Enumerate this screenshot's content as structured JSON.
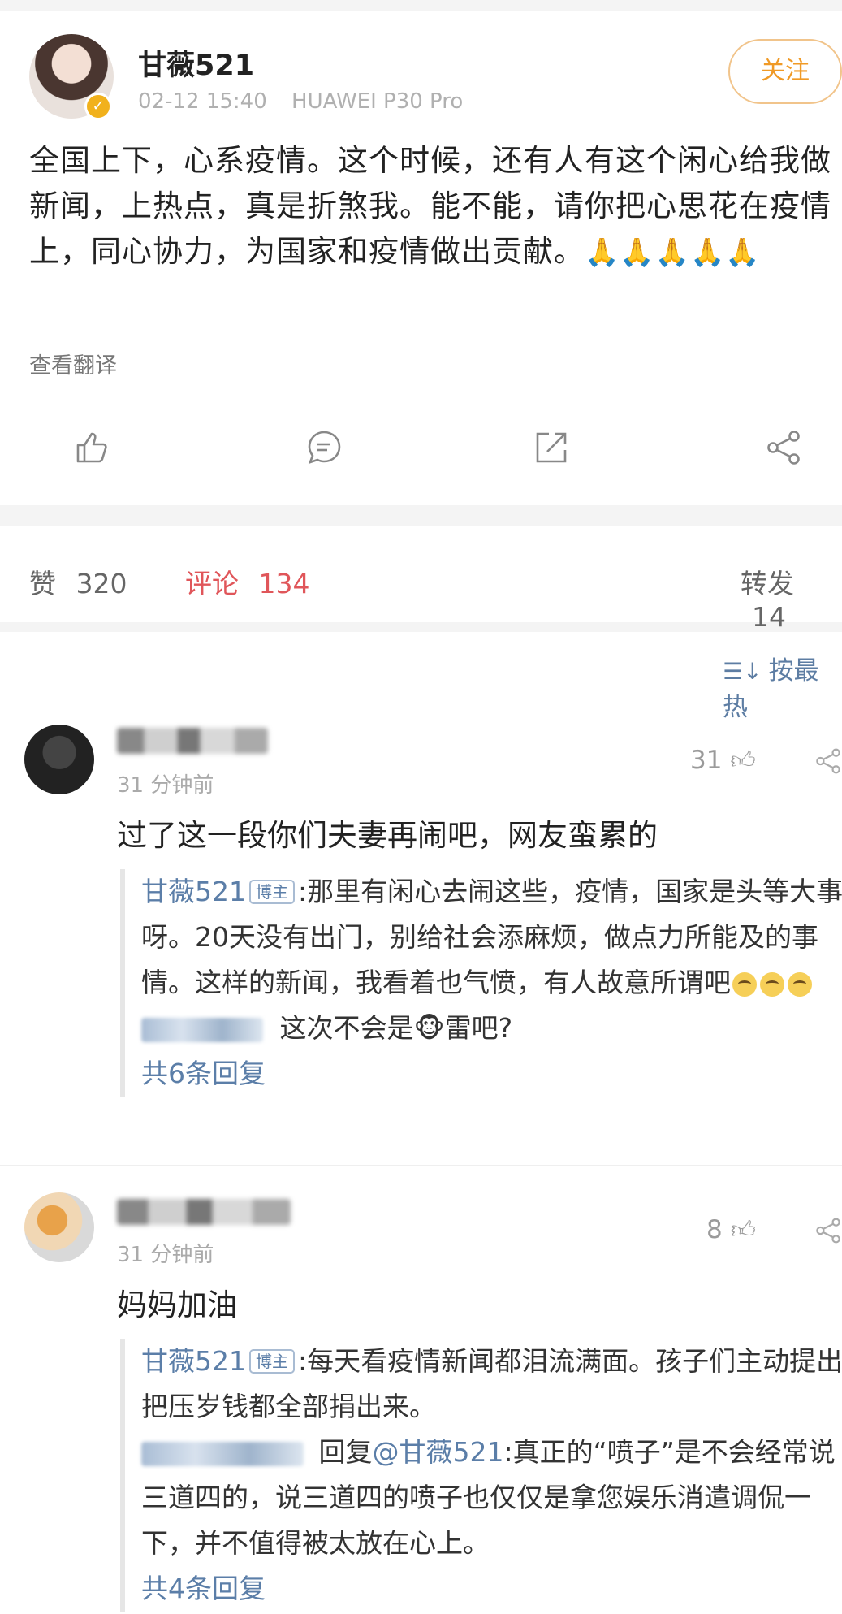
{
  "post": {
    "username": "甘薇521",
    "time": "02-12 15:40",
    "device": "HUAWEI P30 Pro",
    "follow_label": "关注",
    "text": "全国上下，心系疫情。这个时候，还有人有这个闲心给我做新闻，上热点，真是折煞我。能不能，请你把心思花在疫情上，同心协力，为国家和疫情做出贡献。",
    "emoji": "🙏🙏🙏🙏🙏",
    "translate_label": "查看翻译",
    "actions": [
      "thumb-up-icon",
      "comment-icon",
      "share-out-icon",
      "share-icon"
    ]
  },
  "stats": {
    "likes_label": "赞",
    "likes_count": "320",
    "comments_label": "评论",
    "comments_count": "134",
    "reposts_label": "转发",
    "reposts_count": "14"
  },
  "sort_label": "按最热",
  "comments": [
    {
      "time": "31 分钟前",
      "likes": "31",
      "text": "过了这一段你们夫妻再闹吧，网友蛮累的",
      "reply_author": "甘薇521",
      "author_tag": "博主",
      "reply_text": ":那里有闲心去闹这些，疫情，国家是头等大事呀。20天没有出门，别给社会添麻烦，做点力所能及的事情。这样的新闻，我看着也气愤，有人故意所谓吧",
      "sub_reply_text": "这次不会是🐵雷吧?",
      "more_label": "共6条回复"
    },
    {
      "time": "31 分钟前",
      "likes": "8",
      "text": "妈妈加油",
      "reply_author": "甘薇521",
      "author_tag": "博主",
      "reply_text": ":每天看疫情新闻都泪流满面。孩子们主动提出把压岁钱都全部捐出来。",
      "sub_reply_prefix": "回复",
      "sub_reply_mention": "@甘薇521",
      "sub_reply_text": ":真正的“喷子”是不会经常说三道四的，说三道四的喷子也仅仅是拿您娱乐消遣调侃一下，并不值得被太放在心上。",
      "more_label": "共4条回复"
    }
  ]
}
